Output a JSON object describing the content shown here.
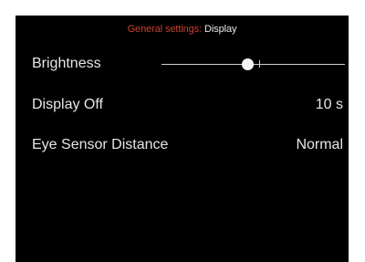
{
  "header": {
    "category": "General settings",
    "separator": ":",
    "page": "Display"
  },
  "settings": {
    "brightness": {
      "label": "Brightness",
      "level": 0.47,
      "default_marker": 0.53
    },
    "display_off": {
      "label": "Display Off",
      "value": "10 s"
    },
    "eye_sensor_distance": {
      "label": "Eye Sensor Distance",
      "value": "Normal"
    }
  },
  "colors": {
    "background": "#000000",
    "accent": "#c8412b",
    "text": "#e6e6e6"
  }
}
